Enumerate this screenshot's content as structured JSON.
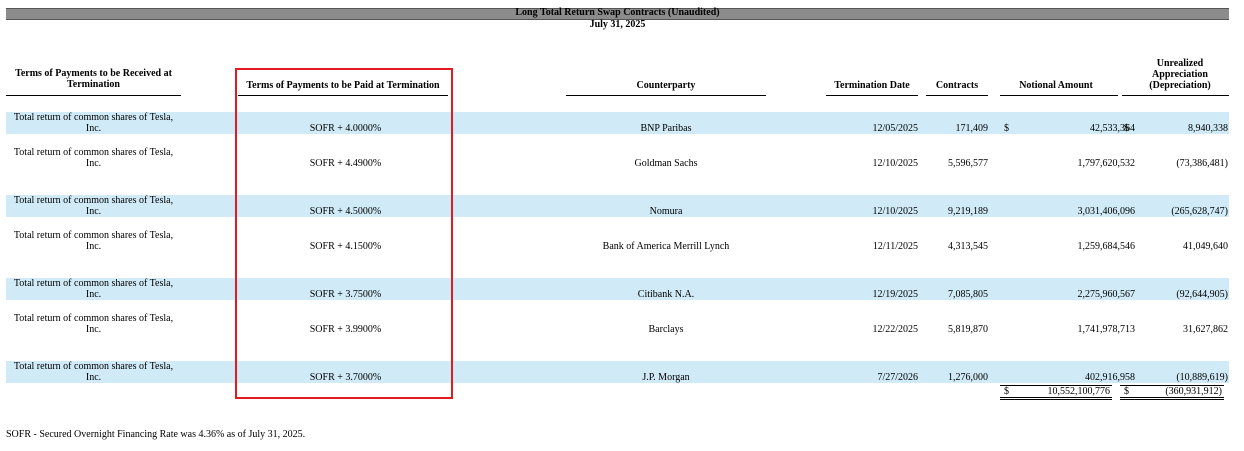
{
  "title": "Long Total Return Swap Contracts (Unaudited)",
  "subtitle": "July 31, 2025",
  "headers": {
    "received": "Terms of Payments to be Received at Termination",
    "paid": "Terms of Payments to be Paid at Termination",
    "counterparty": "Counterparty",
    "termination_date": "Termination Date",
    "contracts": "Contracts",
    "notional": "Notional Amount",
    "unrealized_1": "Unrealized",
    "unrealized_2": "Appreciation",
    "unrealized_3": "(Depreciation)"
  },
  "rows": [
    {
      "received": "Total return of common shares of Tesla, Inc.",
      "paid": "SOFR + 4.0000%",
      "counterparty": "BNP Paribas",
      "date": "12/05/2025",
      "contracts": "171,409",
      "dollar_notional": "$",
      "notional": "42,533,364",
      "dollar_unrealized": "$",
      "unrealized": "8,940,338",
      "shaded": true
    },
    {
      "received": "Total return of common shares of Tesla, Inc.",
      "paid": "SOFR + 4.4900%",
      "counterparty": "Goldman Sachs",
      "date": "12/10/2025",
      "contracts": "5,596,577",
      "dollar_notional": "",
      "notional": "1,797,620,532",
      "dollar_unrealized": "",
      "unrealized": "(73,386,481)",
      "shaded": false
    },
    {
      "received": "Total return of common shares of Tesla, Inc.",
      "paid": "SOFR + 4.5000%",
      "counterparty": "Nomura",
      "date": "12/10/2025",
      "contracts": "9,219,189",
      "dollar_notional": "",
      "notional": "3,031,406,096",
      "dollar_unrealized": "",
      "unrealized": "(265,628,747)",
      "shaded": true
    },
    {
      "received": "Total return of common shares of Tesla, Inc.",
      "paid": "SOFR + 4.1500%",
      "counterparty": "Bank of America Merrill Lynch",
      "date": "12/11/2025",
      "contracts": "4,313,545",
      "dollar_notional": "",
      "notional": "1,259,684,546",
      "dollar_unrealized": "",
      "unrealized": "41,049,640",
      "shaded": false
    },
    {
      "received": "Total return of common shares of Tesla, Inc.",
      "paid": "SOFR + 3.7500%",
      "counterparty": "Citibank N.A.",
      "date": "12/19/2025",
      "contracts": "7,085,805",
      "dollar_notional": "",
      "notional": "2,275,960,567",
      "dollar_unrealized": "",
      "unrealized": "(92,644,905)",
      "shaded": true
    },
    {
      "received": "Total return of common shares of Tesla, Inc.",
      "paid": "SOFR + 3.9900%",
      "counterparty": "Barclays",
      "date": "12/22/2025",
      "contracts": "5,819,870",
      "dollar_notional": "",
      "notional": "1,741,978,713",
      "dollar_unrealized": "",
      "unrealized": "31,627,862",
      "shaded": false
    },
    {
      "received": "Total return of common shares of Tesla, Inc.",
      "paid": "SOFR + 3.7000%",
      "counterparty": "J.P. Morgan",
      "date": "7/27/2026",
      "contracts": "1,276,000",
      "dollar_notional": "",
      "notional": "402,916,958",
      "dollar_unrealized": "",
      "unrealized": "(10,889,619)",
      "shaded": true
    }
  ],
  "totals": {
    "dollar_notional": "$",
    "notional": "10,552,100,776",
    "dollar_unrealized": "$",
    "unrealized": "(360,931,912)"
  },
  "footnote": "SOFR - Secured Overnight Financing Rate was 4.36% as of July 31, 2025.",
  "colors": {
    "title_bar": "#8c8c8c",
    "row_shade": "#d0ebf7",
    "highlight_border": "#e21b22"
  }
}
